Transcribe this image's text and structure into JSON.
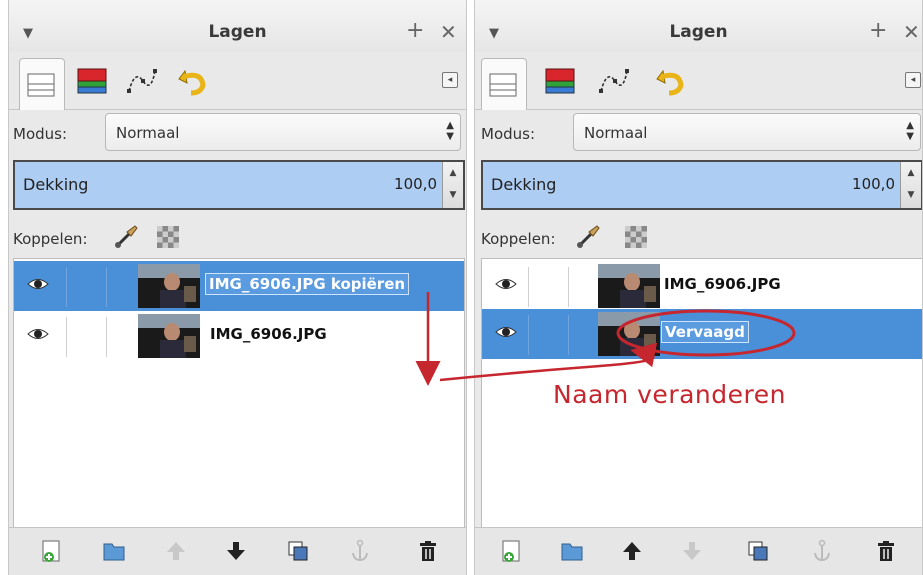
{
  "left_panel": {
    "title": "Lagen",
    "mode_label": "Modus:",
    "mode_value": "Normaal",
    "opacity_label": "Dekking",
    "opacity_value": "100,0",
    "link_label": "Koppelen:",
    "layers": [
      {
        "name": "IMG_6906.JPG kopiëren",
        "selected": true,
        "visible": true
      },
      {
        "name": "IMG_6906.JPG",
        "selected": false,
        "visible": true
      }
    ]
  },
  "right_panel": {
    "title": "Lagen",
    "mode_label": "Modus:",
    "mode_value": "Normaal",
    "opacity_label": "Dekking",
    "opacity_value": "100,0",
    "link_label": "Koppelen:",
    "layers": [
      {
        "name": "IMG_6906.JPG",
        "selected": false,
        "visible": true
      },
      {
        "name": "Vervaagd",
        "selected": true,
        "visible": true
      }
    ]
  },
  "annotation": {
    "text": "Naam veranderen",
    "color": "#c6262e"
  },
  "icons": {
    "tabs": [
      "layers-icon",
      "channels-icon",
      "paths-icon",
      "undo-history-icon"
    ],
    "bottom": [
      "new-layer-icon",
      "new-layer-group-icon",
      "raise-layer-icon",
      "lower-layer-icon",
      "duplicate-layer-icon",
      "anchor-layer-icon",
      "delete-layer-icon"
    ]
  },
  "colors": {
    "selection": "#4a90d9",
    "opacity_fill": "#aecdf3"
  }
}
